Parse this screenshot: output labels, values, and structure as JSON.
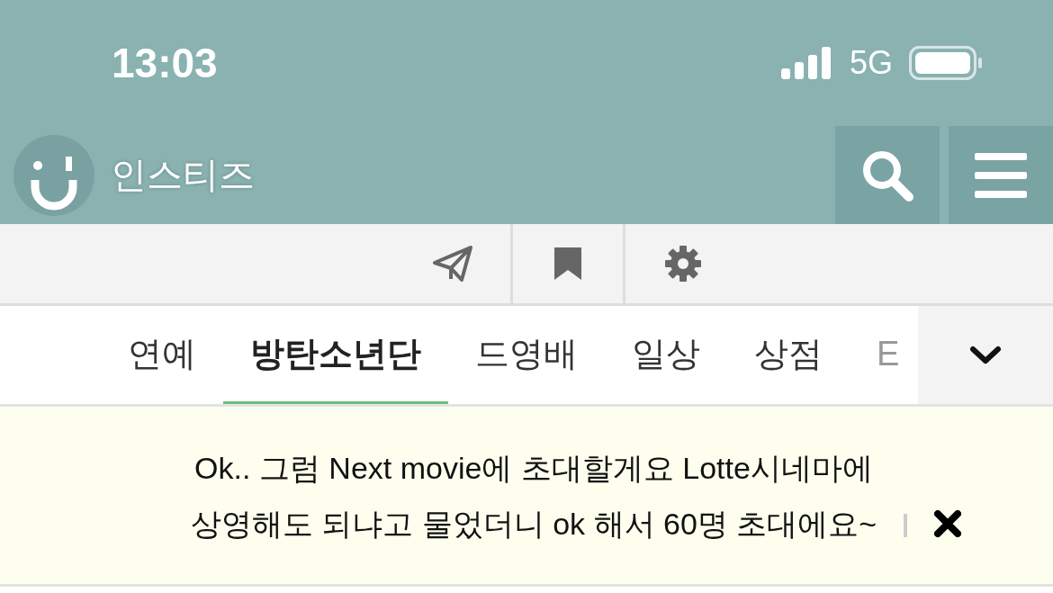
{
  "status_bar": {
    "time": "13:03",
    "network": "5G"
  },
  "header": {
    "logo_text": "인스티즈"
  },
  "tabs": [
    {
      "label": "연예",
      "selected": false
    },
    {
      "label": "방탄소년단",
      "selected": true
    },
    {
      "label": "드영배",
      "selected": false
    },
    {
      "label": "일상",
      "selected": false
    },
    {
      "label": "상점",
      "selected": false
    },
    {
      "label": "E",
      "selected": false
    }
  ],
  "notice": {
    "text": "Ok.. 그럼 Next movie에 초대할게요 Lotte시네마에\n상영해도 되냐고 물었더니 ok 해서 60명 초대에요~"
  }
}
